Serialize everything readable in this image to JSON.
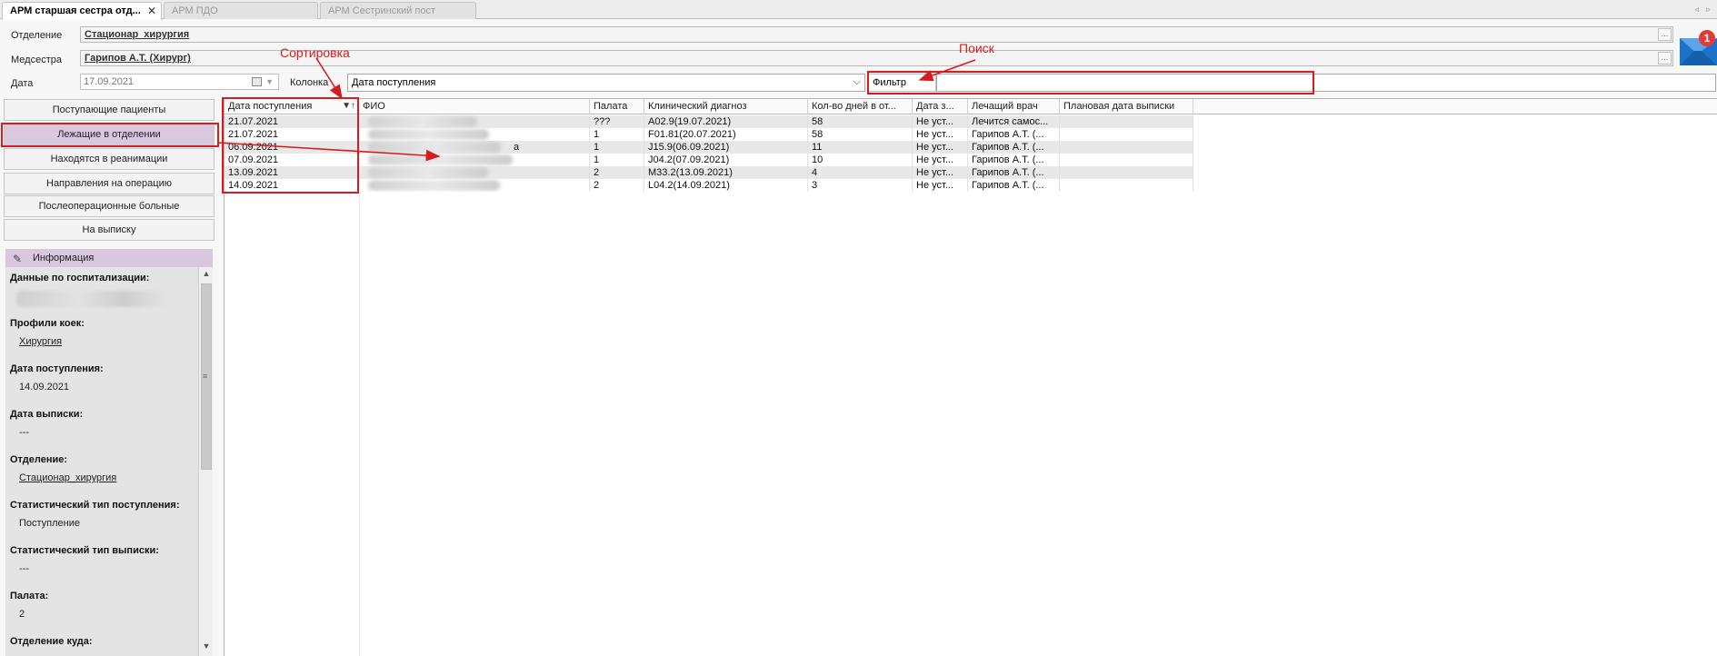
{
  "tabs": [
    {
      "label": "АРМ старшая сестра отд...",
      "close": "✕",
      "active": true
    },
    {
      "label": "АРМ ПДО",
      "active": false
    },
    {
      "label": "АРМ Сестринский пост",
      "active": false
    }
  ],
  "tab_nav": "◃ ▹",
  "form": {
    "department_label": "Отделение",
    "department_value": "Стационар_хирургия",
    "nurse_label": "Медсестра",
    "nurse_value": "Гарипов А.Т. (Хирург)",
    "date_label": "Дата",
    "date_value": "17.09.2021",
    "column_label": "Колонка",
    "column_value": "Дата поступления",
    "filter_label": "Фильтр",
    "filter_value": "",
    "dots": "..."
  },
  "mail": {
    "badge": "1",
    "accent": "#1a73c9",
    "badge_color": "#e53935"
  },
  "nav": [
    {
      "label": "Поступающие пациенты",
      "selected": false
    },
    {
      "label": "Лежащие в отделении",
      "selected": true
    },
    {
      "label": "Находятся в реанимации",
      "selected": false
    },
    {
      "label": "Направления на операцию",
      "selected": false
    },
    {
      "label": "Послеоперационные больные",
      "selected": false
    },
    {
      "label": "На выписку",
      "selected": false
    }
  ],
  "info": {
    "title": "Информация",
    "fields": [
      {
        "title": "Данные по госпитализации:",
        "value": "",
        "link": false
      },
      {
        "title": "Профили коек:",
        "value": "Хирургия",
        "link": true
      },
      {
        "title": "Дата поступления:",
        "value": "14.09.2021",
        "link": false
      },
      {
        "title": "Дата выписки:",
        "value": "---",
        "link": false
      },
      {
        "title": "Отделение:",
        "value": "Стационар_хирургия",
        "link": true
      },
      {
        "title": "Статистический тип поступления:",
        "value": "Поступление",
        "link": false
      },
      {
        "title": "Статистический тип выписки:",
        "value": "---",
        "link": false
      },
      {
        "title": "Палата:",
        "value": "2",
        "link": false
      },
      {
        "title": "Отделение куда:",
        "value": "",
        "link": false
      }
    ]
  },
  "grid": {
    "columns": [
      "Дата поступления",
      "ФИО",
      "Палата",
      "Клинический диагноз",
      "Кол-во дней в от...",
      "Дата з...",
      "Лечащий врач",
      "Плановая дата выписки"
    ],
    "sort_icon": "▼↑",
    "rows": [
      {
        "date": "21.07.2021",
        "fio_suffix": "",
        "ward": "???",
        "diagnosis": "A02.9(19.07.2021)",
        "days": "58",
        "date_z": "Не уст...",
        "doctor": "Лечится самос...",
        "plan": ""
      },
      {
        "date": "21.07.2021",
        "fio_suffix": "",
        "ward": "1",
        "diagnosis": "F01.81(20.07.2021)",
        "days": "58",
        "date_z": "Не уст...",
        "doctor": "Гарипов А.Т. (...",
        "plan": ""
      },
      {
        "date": "06.09.2021",
        "fio_suffix": "а",
        "ward": "1",
        "diagnosis": "J15.9(06.09.2021)",
        "days": "11",
        "date_z": "Не уст...",
        "doctor": "Гарипов А.Т. (...",
        "plan": ""
      },
      {
        "date": "07.09.2021",
        "fio_suffix": "",
        "ward": "1",
        "diagnosis": "J04.2(07.09.2021)",
        "days": "10",
        "date_z": "Не уст...",
        "doctor": "Гарипов А.Т. (...",
        "plan": ""
      },
      {
        "date": "13.09.2021",
        "fio_suffix": "",
        "ward": "2",
        "diagnosis": "M33.2(13.09.2021)",
        "days": "4",
        "date_z": "Не уст...",
        "doctor": "Гарипов А.Т. (...",
        "plan": ""
      },
      {
        "date": "14.09.2021",
        "fio_suffix": "",
        "ward": "2",
        "diagnosis": "L04.2(14.09.2021)",
        "days": "3",
        "date_z": "Не уст...",
        "doctor": "Гарипов А.Т. (...",
        "plan": ""
      }
    ]
  },
  "annotations": {
    "sort": "Сортировка",
    "search": "Поиск",
    "color": "#d61c1c"
  },
  "colors": {
    "selected_nav": "#d9c8de",
    "info_header": "#d8c7de",
    "row_alt": "#e8e8e8"
  }
}
